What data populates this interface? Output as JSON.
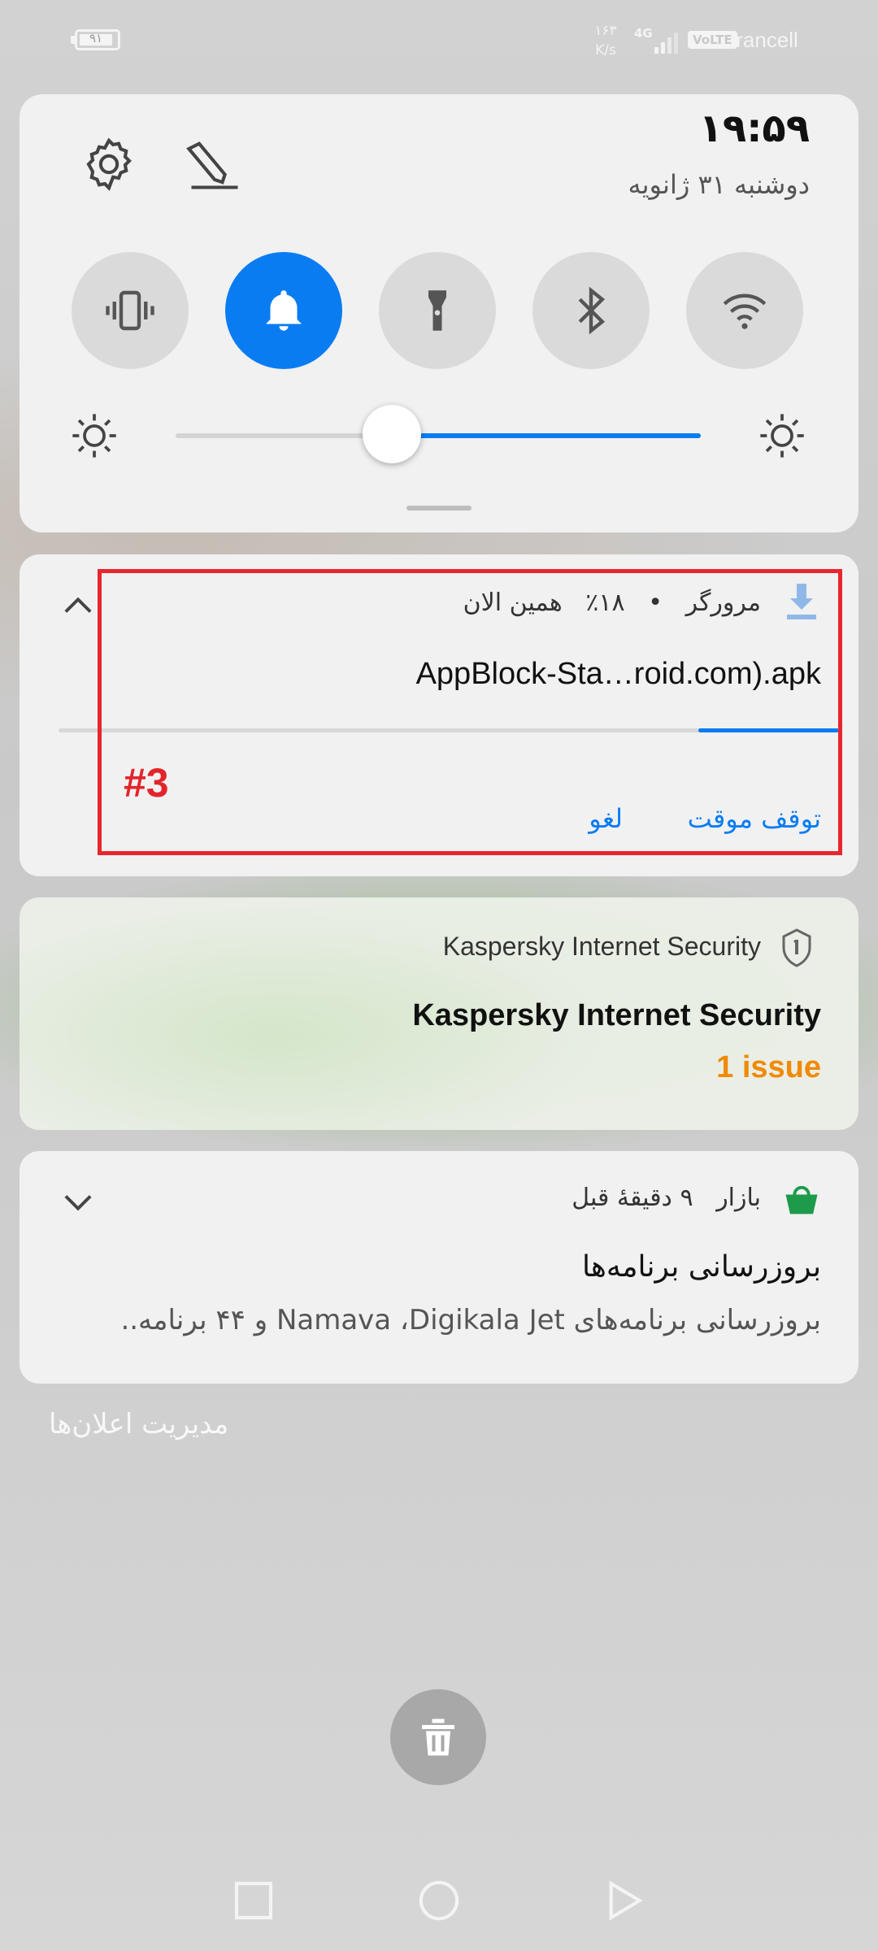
{
  "status_bar": {
    "battery_level": "۹۱",
    "net_speed_value": "۱۶۳",
    "net_speed_unit": "K/s",
    "network_type": "4G",
    "volte_label": "VoLTE",
    "carrier": "Irancell"
  },
  "quick_settings": {
    "time": "۱۹:۵۹",
    "date": "دوشنبه ۳۱ ژانویه",
    "tiles": [
      {
        "name": "vibrate",
        "active": false
      },
      {
        "name": "sound",
        "active": true
      },
      {
        "name": "flashlight",
        "active": false
      },
      {
        "name": "bluetooth",
        "active": false
      },
      {
        "name": "wifi",
        "active": false
      }
    ],
    "brightness_fraction": 0.41,
    "accent_color": "#0a7cf2"
  },
  "notifications": {
    "download": {
      "app_name": "مرورگر",
      "separator": "•",
      "progress_label": "۱۸٪",
      "time": "همین الان",
      "title": "AppBlock-Sta…roid.com).apk",
      "progress": 0.18,
      "action_pause": "توقف موقت",
      "action_cancel": "لغو"
    },
    "kaspersky": {
      "app_name": "Kaspersky Internet Security",
      "title": "Kaspersky Internet Security",
      "issue_text": "1 issue",
      "issue_color": "#f08a00"
    },
    "bazaar": {
      "app_name": "بازار",
      "time": "۹ دقیقهٔ قبل",
      "title": "بروزرسانی برنامه‌ها",
      "body": "بروزرسانی برنامه‌های Namava ،Digikala Jet و ۴۴ برنامه..",
      "icon_color": "#1d9a4a"
    }
  },
  "highlight_label": "#3",
  "manage_notifications": "مدیریت اعلان‌ها"
}
